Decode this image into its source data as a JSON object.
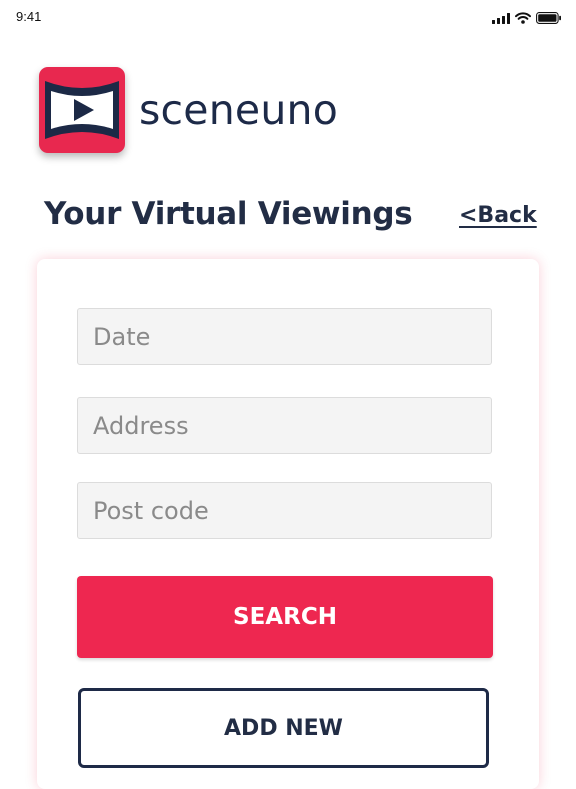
{
  "status_bar": {
    "time": "9:41"
  },
  "brand": {
    "name": "sceneuno",
    "accent_color": "#e8284f",
    "dark_color": "#1d2a48"
  },
  "header": {
    "title": "Your Virtual Viewings",
    "back_label": "<Back"
  },
  "form": {
    "date_placeholder": "Date",
    "address_placeholder": "Address",
    "postcode_placeholder": "Post code",
    "search_label": "SEARCH",
    "add_new_label": "ADD NEW"
  },
  "icons": {
    "signal": "cellular-signal-icon",
    "wifi": "wifi-icon",
    "battery": "battery-icon",
    "logo": "play-video-logo-icon"
  }
}
